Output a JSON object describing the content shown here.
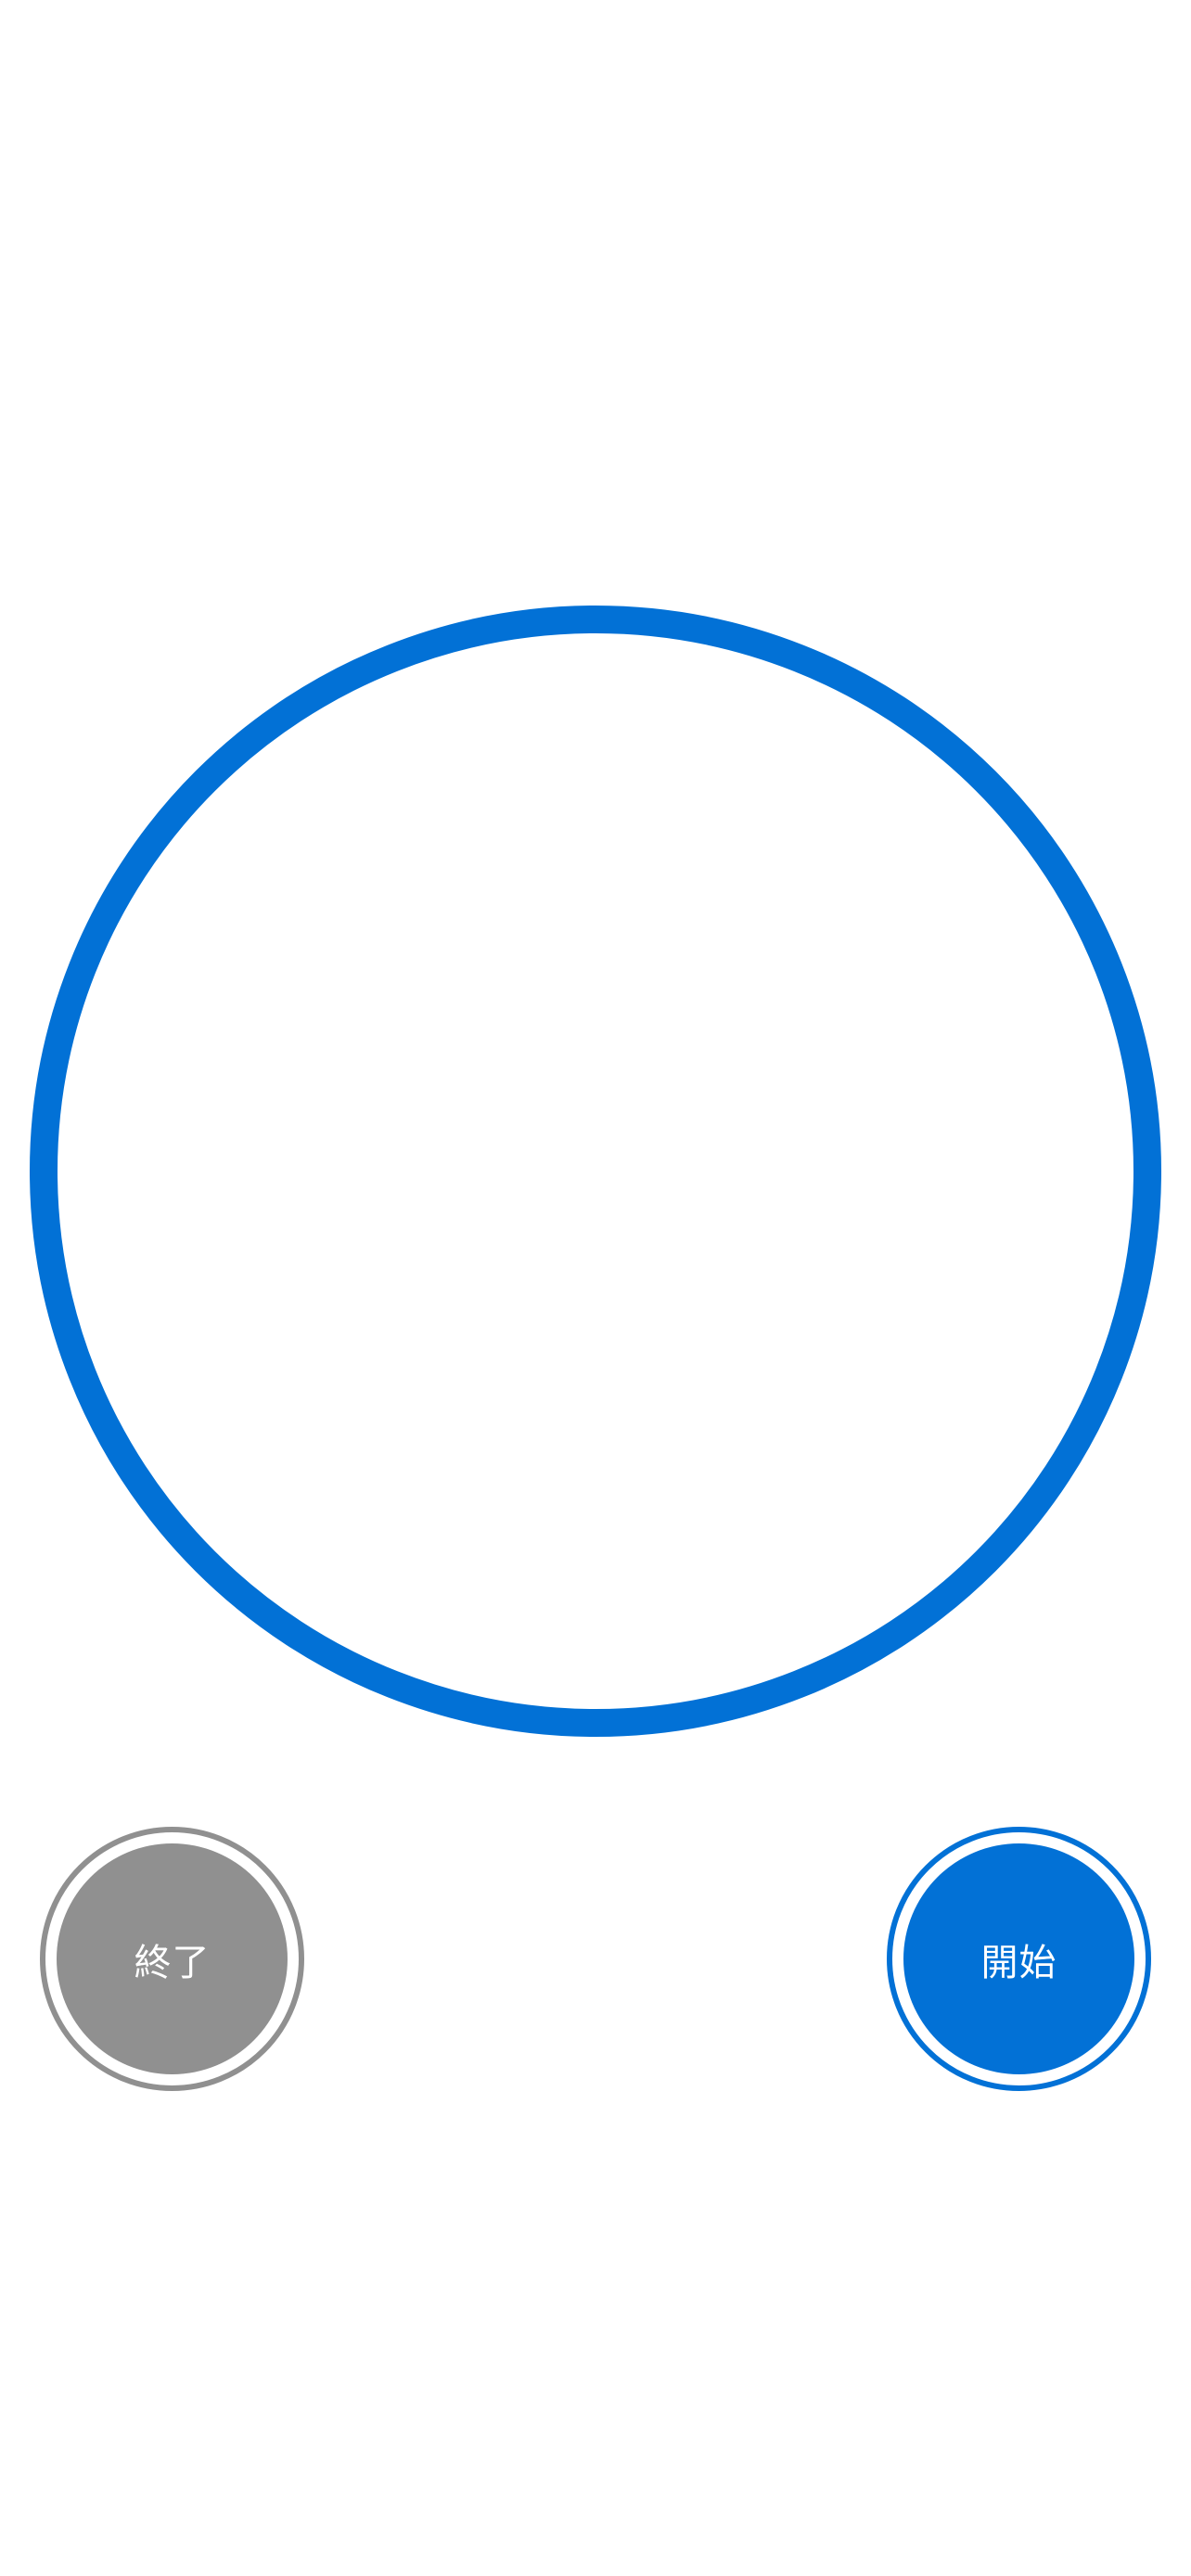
{
  "timer": {
    "ring_color": "#0271d6"
  },
  "controls": {
    "stop_label": "終了",
    "start_label": "開始",
    "stop_color": "#909090",
    "start_color": "#0271d6"
  }
}
